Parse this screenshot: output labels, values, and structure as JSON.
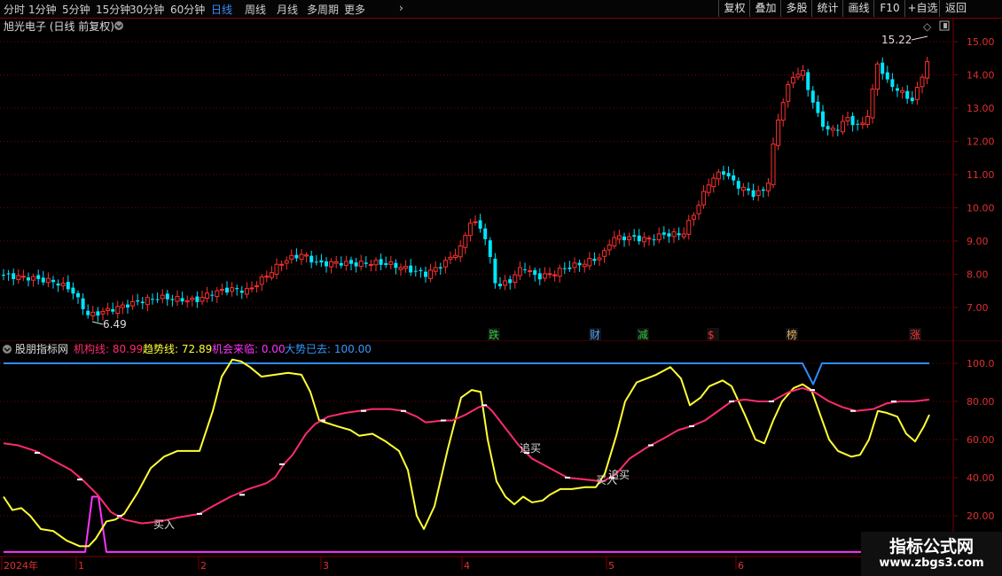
{
  "toolbar": {
    "tabs": [
      "分时",
      "1分钟",
      "5分钟",
      "15分钟",
      "30分钟",
      "60分钟",
      "日线",
      "周线",
      "月线",
      "多周期",
      "更多"
    ],
    "active_tab": "日线",
    "more_arrow": "›",
    "right_buttons": [
      "复权",
      "叠加",
      "多股",
      "统计",
      "画线",
      "F10",
      "+自选",
      "返回"
    ]
  },
  "main": {
    "title": "旭光电子 (日线 前复权)",
    "price_axis": [
      "15.00",
      "14.00",
      "13.00",
      "12.00",
      "11.00",
      "10.00",
      "9.00",
      "8.00",
      "7.00"
    ],
    "high_label": "15.22",
    "low_label": "6.49",
    "events": [
      {
        "label": "跌",
        "color": "#2ecc40"
      },
      {
        "label": "财",
        "color": "#4aa3ff"
      },
      {
        "label": "减",
        "color": "#2ecc40"
      },
      {
        "label": "$",
        "color": "#ff3030"
      },
      {
        "label": "榜",
        "color": "#e0b060"
      },
      {
        "label": "涨",
        "color": "#ff3030"
      }
    ],
    "icons": {
      "diamond": "◇",
      "settings": "▣"
    }
  },
  "indicator": {
    "name": "股朋指标网",
    "values": [
      {
        "label": "机构线: 80.99",
        "color": "#ff2a6d"
      },
      {
        "label": "趋势线: 72.89",
        "color": "#ffff33"
      },
      {
        "label": "机会来临: 0.00",
        "color": "#ff33ff"
      },
      {
        "label": "大势已去: 100.00",
        "color": "#3399ff"
      }
    ],
    "y_axis": [
      "100.0",
      "80.00",
      "60.00",
      "40.00",
      "20.00"
    ],
    "annotations": [
      "买入",
      "追买",
      "买入",
      "追买"
    ]
  },
  "date_axis": [
    "2024年",
    "1",
    "2",
    "3",
    "4",
    "5",
    "6"
  ],
  "watermark": {
    "title": "指标公式网",
    "url": "www.zbgs3.com"
  },
  "colors": {
    "up": "#ff3030",
    "down": "#00e5ff",
    "grid": "#7a0000",
    "axis_text": "#cc2222"
  }
}
